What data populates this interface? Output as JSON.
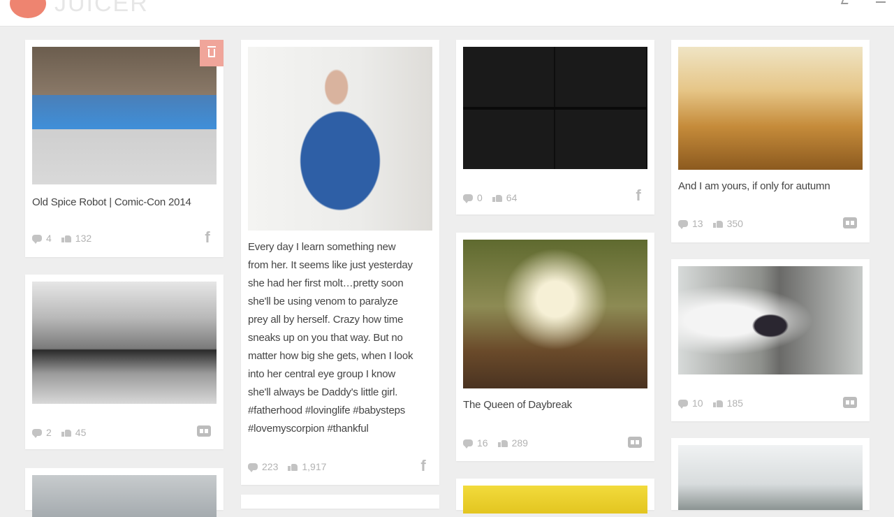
{
  "app": {
    "logo_text": "JUICER",
    "accent_color": "#ee8470"
  },
  "topbar": {
    "icons": [
      "share-icon",
      "menu-icon"
    ]
  },
  "posts": [
    {
      "caption": "Old Spice Robot | Comic-Con 2014",
      "comments": "4",
      "likes": "132",
      "source": "facebook-icon",
      "photo": "convention-photo",
      "has_delete": true
    },
    {
      "caption": "Every day I learn something new from her. It seems like just yesterday she had her first molt…pretty soon she'll be using venom to paralyze prey all by herself. Crazy how time sneaks up on you that way. But no matter how big she gets, when I look into her central eye group I know she'll always be Daddy's little girl. #fatherhood #lovinglife #babysteps #lovemyscorpion #thankful",
      "caption_lines": [
        "Every day I learn something new",
        "from her. It seems like just yesterday",
        "she had her first molt…pretty soon",
        "she'll be using venom to paralyze",
        "prey all by herself. Crazy how time",
        "sneaks up on you that way. But no",
        "matter how big she gets, when I look",
        "into her central eye group I know",
        "she'll always be Daddy's little girl.",
        "#fatherhood #lovinglife #babysteps",
        "#lovemyscorpion #thankful"
      ],
      "comments": "223",
      "likes": "1,917",
      "source": "facebook-icon",
      "photo": "dad-with-scorpion-photo"
    },
    {
      "caption": "",
      "comments": "0",
      "likes": "64",
      "source": "facebook-icon",
      "photo": "press-wall-photo"
    },
    {
      "caption": "And I am yours, if only for autumn",
      "comments": "13",
      "likes": "350",
      "source": "flickr-icon",
      "photo": "autumn-forest-photo"
    },
    {
      "caption": "",
      "comments": "2",
      "likes": "45",
      "source": "flickr-icon",
      "photo": "carousel-photo"
    },
    {
      "caption": "The Queen of Daybreak",
      "comments": "16",
      "likes": "289",
      "source": "flickr-icon",
      "photo": "forest-queen-photo"
    },
    {
      "caption": "",
      "comments": "10",
      "likes": "185",
      "source": "flickr-icon",
      "photo": "smoke-portrait-photo"
    },
    {
      "caption": "",
      "photo": "snowy-trees-photo"
    },
    {
      "caption": "",
      "photo": "sky-photo"
    },
    {
      "caption": "",
      "photo": "yellow-photo"
    }
  ]
}
